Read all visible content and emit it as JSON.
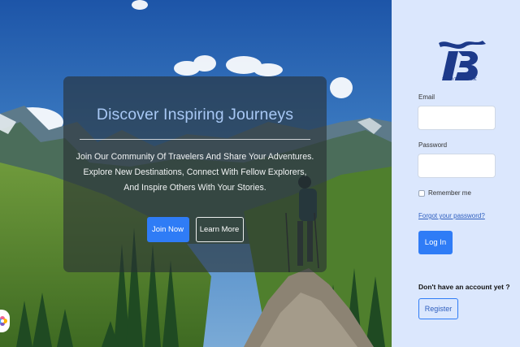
{
  "hero": {
    "title": "Discover Inspiring Journeys",
    "text": "Join Our Community Of Travelers And Share Your Adventures. Explore New Destinations, Connect With Fellow Explorers, And Inspire Others With Your Stories.",
    "join_label": "Join Now",
    "more_label": "Learn More"
  },
  "login": {
    "logo_text": "TRAVEL BOOK",
    "email_label": "Email",
    "email_value": "",
    "password_label": "Password",
    "password_value": "",
    "remember_label": "Remember me",
    "remember_checked": false,
    "forgot_label": "Forgot your password?",
    "login_label": "Log In",
    "no_account_text": "Don't have an account yet ?",
    "register_label": "Register"
  },
  "colors": {
    "accent": "#2f7cf6",
    "panel_bg": "#dbe7fd",
    "title_blue": "#a8c8f5"
  },
  "icons": {
    "logo": "travel-book-logo",
    "floating": "flower-icon"
  }
}
